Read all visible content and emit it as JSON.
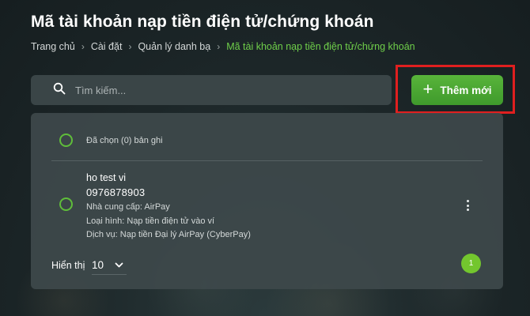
{
  "page": {
    "title": "Mã tài khoản nạp tiền điện tử/chứng khoán"
  },
  "breadcrumb": {
    "items": [
      "Trang chủ",
      "Cài đặt",
      "Quản lý danh bạ",
      "Mã tài khoản nạp tiền điện tử/chứng khoán"
    ],
    "separator": "›"
  },
  "search": {
    "placeholder": "Tìm kiếm...",
    "value": "",
    "icon": "search-icon"
  },
  "toolbar": {
    "add_label": "Thêm mới",
    "add_icon": "plus-icon",
    "accent": "#4aa832",
    "highlight_color": "#e01f1f"
  },
  "list": {
    "selected_text": "Đã chọn (0) bản ghi",
    "records": [
      {
        "name": "ho test vi",
        "number": "0976878903",
        "provider": "Nhà cung cấp: AirPay",
        "type": "Loại hình: Nạp tiền điện tử vào ví",
        "service": "Dịch vụ: Nạp tiền Đại lý AirPay (CyberPay)"
      }
    ]
  },
  "pagination": {
    "page_size_label": "Hiển thị",
    "page_size": "10",
    "current_page": "1"
  }
}
